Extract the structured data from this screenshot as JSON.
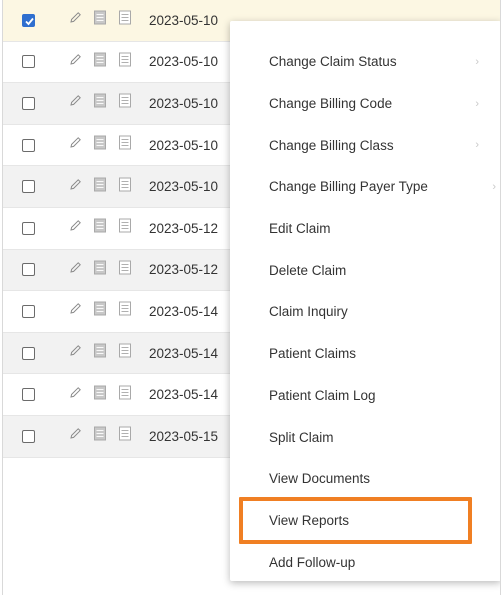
{
  "rows": [
    {
      "date": "2023-05-10",
      "checked": true,
      "state": "selected",
      "edge": ""
    },
    {
      "date": "2023-05-10",
      "checked": false,
      "state": "normal",
      "edge": ""
    },
    {
      "date": "2023-05-10",
      "checked": false,
      "state": "alt",
      "edge": ""
    },
    {
      "date": "2023-05-10",
      "checked": false,
      "state": "normal",
      "edge": "c"
    },
    {
      "date": "2023-05-10",
      "checked": false,
      "state": "alt",
      "edge": ""
    },
    {
      "date": "2023-05-12",
      "checked": false,
      "state": "normal",
      "edge": "t"
    },
    {
      "date": "2023-05-12",
      "checked": false,
      "state": "alt",
      "edge": ""
    },
    {
      "date": "2023-05-14",
      "checked": false,
      "state": "normal",
      "edge": ""
    },
    {
      "date": "2023-05-14",
      "checked": false,
      "state": "alt",
      "edge": ""
    },
    {
      "date": "2023-05-14",
      "checked": false,
      "state": "normal",
      "edge": ""
    },
    {
      "date": "2023-05-15",
      "checked": false,
      "state": "alt",
      "edge": "("
    }
  ],
  "context_menu": {
    "items": [
      {
        "label": "Change Claim Status",
        "has_submenu": true
      },
      {
        "label": "Change Billing Code",
        "has_submenu": true
      },
      {
        "label": "Change Billing Class",
        "has_submenu": true
      },
      {
        "label": "Change Billing Payer Type",
        "has_submenu": true
      },
      {
        "label": "Edit Claim",
        "has_submenu": false
      },
      {
        "label": "Delete Claim",
        "has_submenu": false
      },
      {
        "label": "Claim Inquiry",
        "has_submenu": false
      },
      {
        "label": "Patient Claims",
        "has_submenu": false
      },
      {
        "label": "Patient Claim Log",
        "has_submenu": false
      },
      {
        "label": "Split Claim",
        "has_submenu": false
      },
      {
        "label": "View Documents",
        "has_submenu": false
      },
      {
        "label": "View Reports",
        "has_submenu": false
      },
      {
        "label": "Add Follow-up",
        "has_submenu": false
      }
    ],
    "highlighted": "View Reports"
  },
  "icons": {
    "edit": "pencil-icon",
    "summary": "summary-document-icon",
    "notes": "notes-document-icon",
    "submenu": "chevron-right-icon",
    "checkbox_check": "check-icon"
  },
  "colors": {
    "highlight_border": "#f07f23",
    "checkbox_checked": "#2f6fcf",
    "selected_row": "#fcf7e3",
    "alt_row": "#f2f2f2"
  }
}
